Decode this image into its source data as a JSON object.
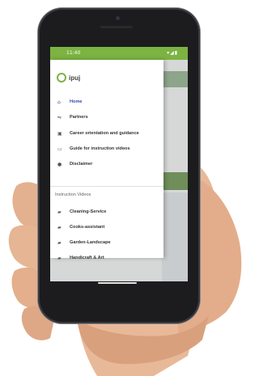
{
  "statusbar": {
    "time": "11:40",
    "icons": "▾◢▮"
  },
  "app": {
    "logo_text": "ipuj"
  },
  "drawer": {
    "items": [
      {
        "label": "Home",
        "icon": "home-icon",
        "glyph": "⌂"
      },
      {
        "label": "Partners",
        "icon": "handshake-icon",
        "glyph": "⇋"
      },
      {
        "label": "Career orientation and guidance",
        "icon": "briefcase-icon",
        "glyph": "▣"
      },
      {
        "label": "Guide for instruction videos",
        "icon": "video-guide-icon",
        "glyph": "▭"
      },
      {
        "label": "Disclaimer",
        "icon": "info-icon",
        "glyph": "●"
      }
    ],
    "section_title": "Instruction Videos",
    "videos": [
      {
        "label": "Cleaning-Service",
        "icon": "video-icon",
        "glyph": "▰"
      },
      {
        "label": "Cooks-assistant",
        "icon": "video-icon",
        "glyph": "▰"
      },
      {
        "label": "Garden-Landscape",
        "icon": "video-icon",
        "glyph": "▰"
      },
      {
        "label": "Handicraft & Art",
        "icon": "video-icon",
        "glyph": "▰"
      }
    ]
  },
  "colors": {
    "accent": "#7cb342",
    "active": "#3949ab"
  }
}
